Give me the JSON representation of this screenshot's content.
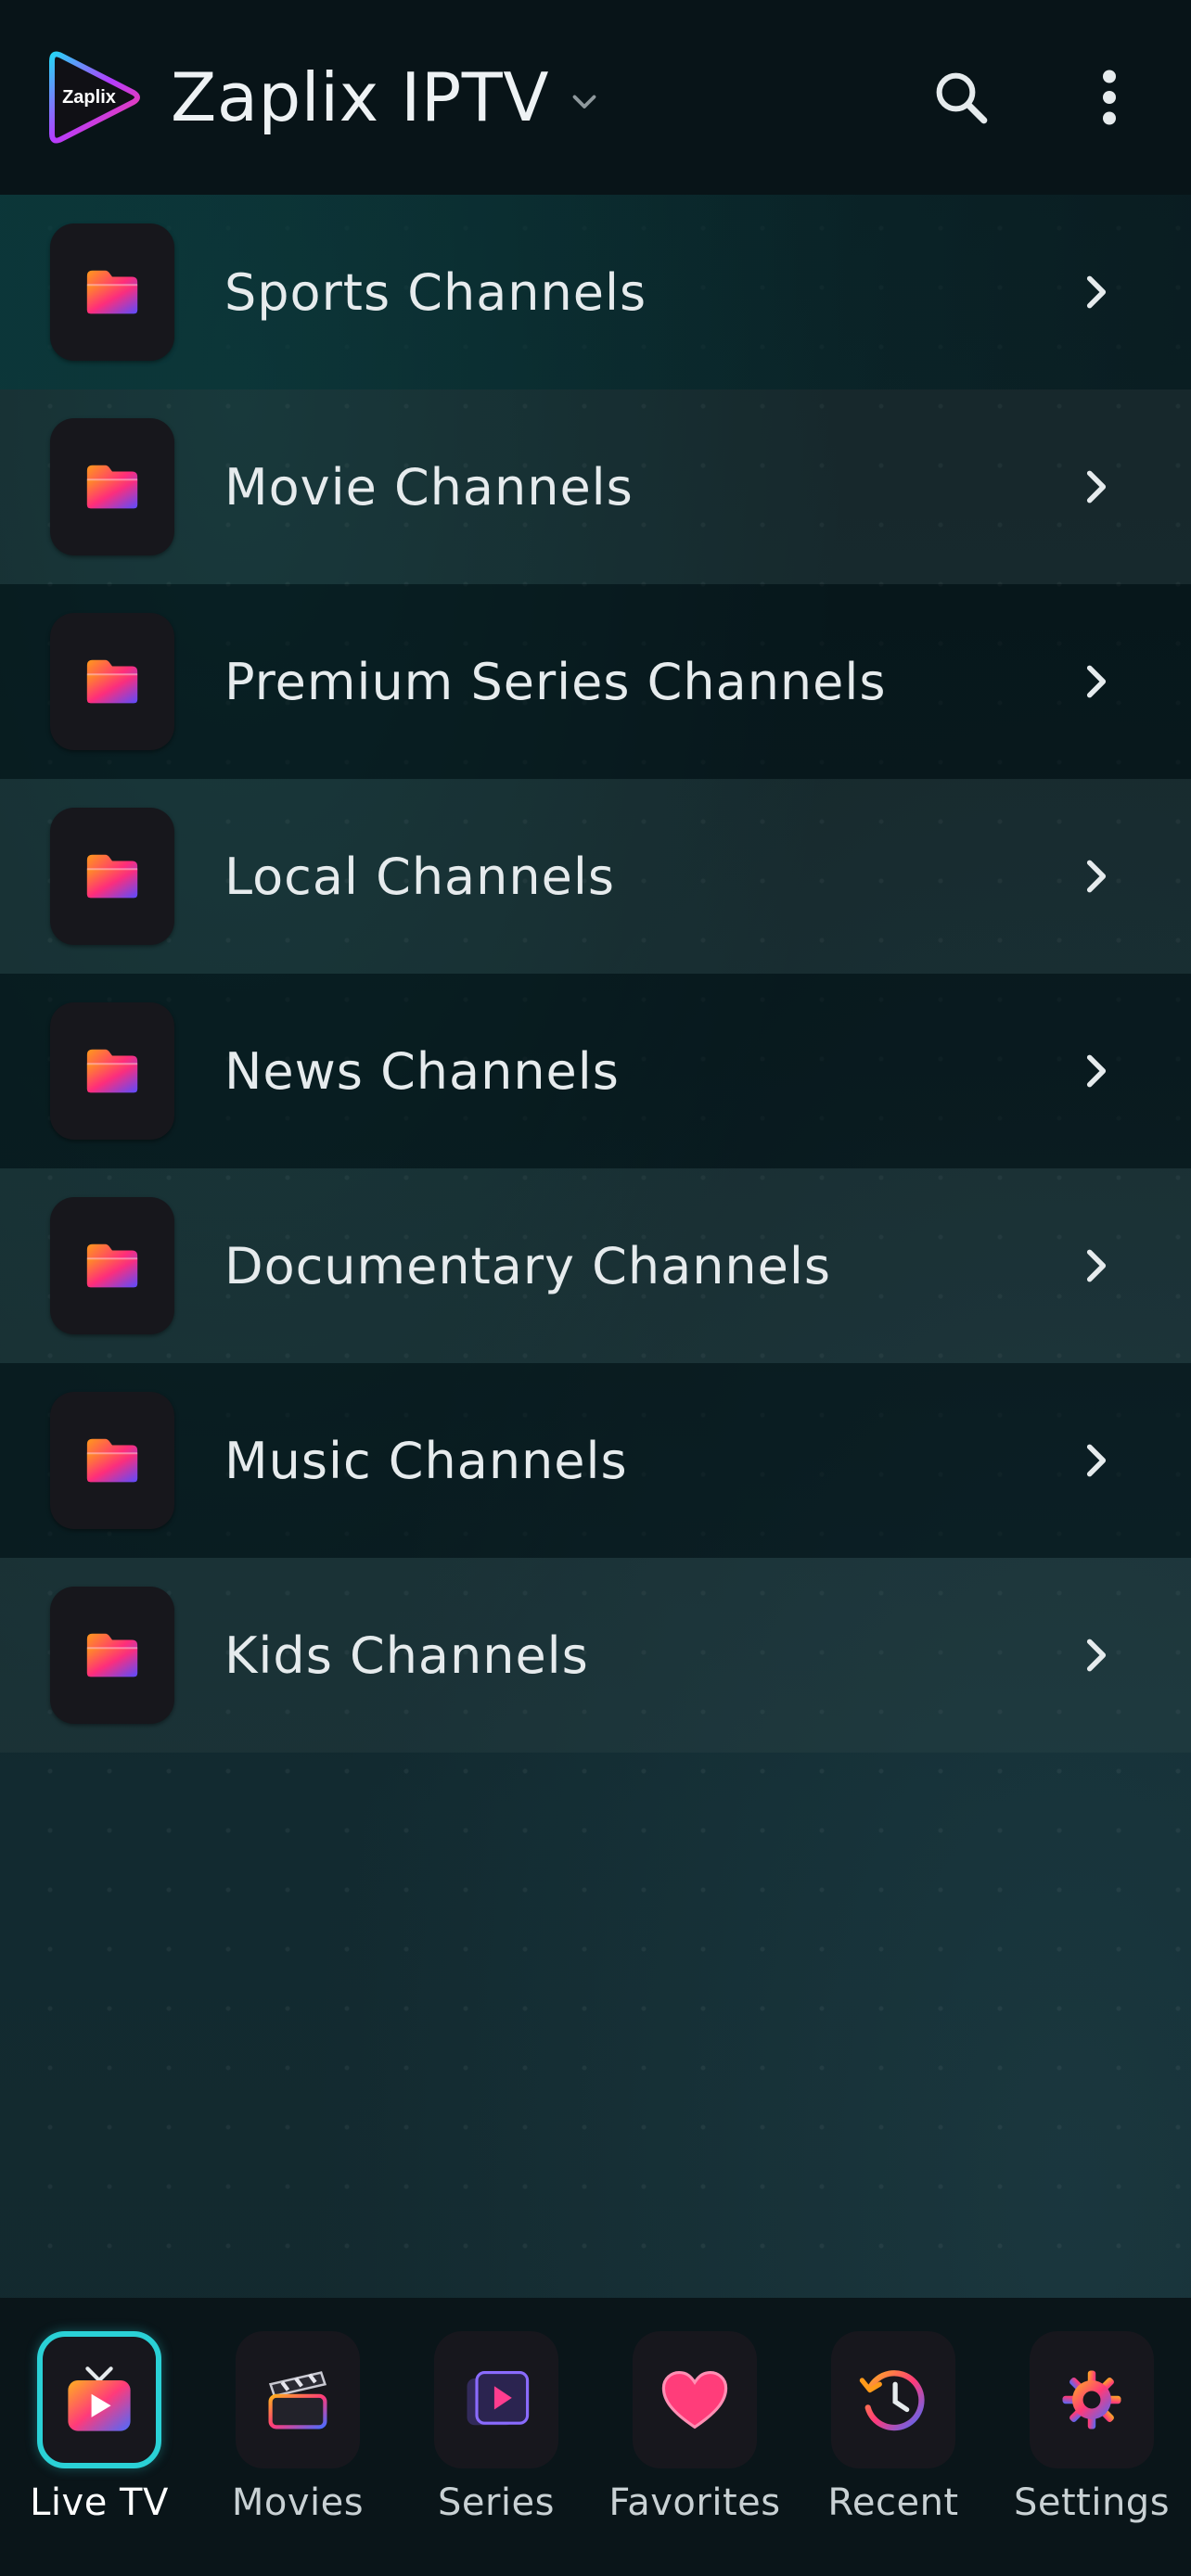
{
  "header": {
    "app_title": "Zaplix IPTV",
    "logo_text": "Zaplix",
    "icons": {
      "title_dropdown": "chevron-down-icon",
      "search": "search-icon",
      "more": "more-vertical-icon"
    }
  },
  "categories": [
    {
      "label": "Sports Channels",
      "icon": "folder-icon"
    },
    {
      "label": "Movie Channels",
      "icon": "folder-icon"
    },
    {
      "label": "Premium Series Channels",
      "icon": "folder-icon"
    },
    {
      "label": "Local Channels",
      "icon": "folder-icon"
    },
    {
      "label": "News Channels",
      "icon": "folder-icon"
    },
    {
      "label": "Documentary Channels",
      "icon": "folder-icon"
    },
    {
      "label": "Music Channels",
      "icon": "folder-icon"
    },
    {
      "label": "Kids Channels",
      "icon": "folder-icon"
    }
  ],
  "bottom_nav": {
    "selected": "Live TV",
    "items": [
      {
        "label": "Live TV",
        "icon": "live-tv-icon"
      },
      {
        "label": "Movies",
        "icon": "clapperboard-icon"
      },
      {
        "label": "Series",
        "icon": "series-play-icon"
      },
      {
        "label": "Favorites",
        "icon": "heart-icon"
      },
      {
        "label": "Recent",
        "icon": "history-icon"
      },
      {
        "label": "Settings",
        "icon": "gear-icon"
      }
    ]
  },
  "colors": {
    "accent": "#2ad1d6",
    "header_bg": "#081418",
    "text_primary": "#e6ebed",
    "icon_gradient": [
      "#ff8a1a",
      "#ff2d8a",
      "#6a4bff"
    ]
  }
}
